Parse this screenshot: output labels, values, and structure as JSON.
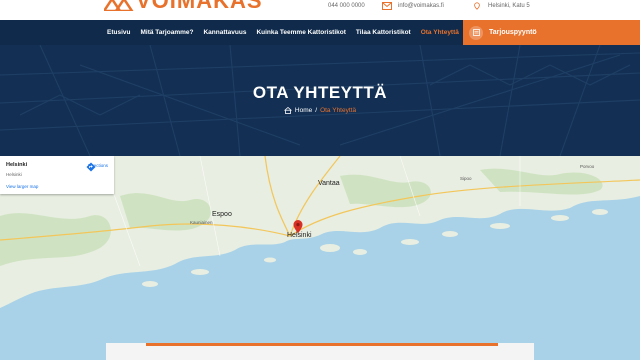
{
  "topbar": {
    "logo_text": "VOIMAKAS",
    "phone": "044 000 0000",
    "email": "info@voimakas.fi",
    "address": "Helsinki, Katu 5"
  },
  "nav": {
    "items": [
      {
        "label": "Etusivu",
        "active": false
      },
      {
        "label": "Mitä Tarjoamme?",
        "active": false
      },
      {
        "label": "Kannattavuus",
        "active": false
      },
      {
        "label": "Kuinka Teemme Kattoristikot",
        "active": false
      },
      {
        "label": "Tilaa Kattoristikot",
        "active": false
      },
      {
        "label": "Ota Yhteyttä",
        "active": true
      }
    ],
    "cta_label": "Tarjouspyyntö"
  },
  "hero": {
    "title": "OTA YHTEYTTÄ",
    "breadcrumb_home": "Home",
    "breadcrumb_sep": "/",
    "breadcrumb_current": "Ota Yhteyttä"
  },
  "map": {
    "card_place": "Helsinki",
    "card_sub": "Helsinki",
    "larger_map": "View larger map",
    "directions": "Directions",
    "labels": {
      "vantaa": "Vantaa",
      "espoo": "Espoo",
      "helsinki": "Helsinki",
      "kauniainen": "Kauniainen",
      "porvoo": "Porvoo",
      "sipoo": "Sipoo"
    }
  },
  "colors": {
    "navy": "#0f2a4a",
    "hero": "#163459",
    "accent": "#e8712b",
    "sea": "#a9d2e8",
    "land": "#e9efe3"
  }
}
